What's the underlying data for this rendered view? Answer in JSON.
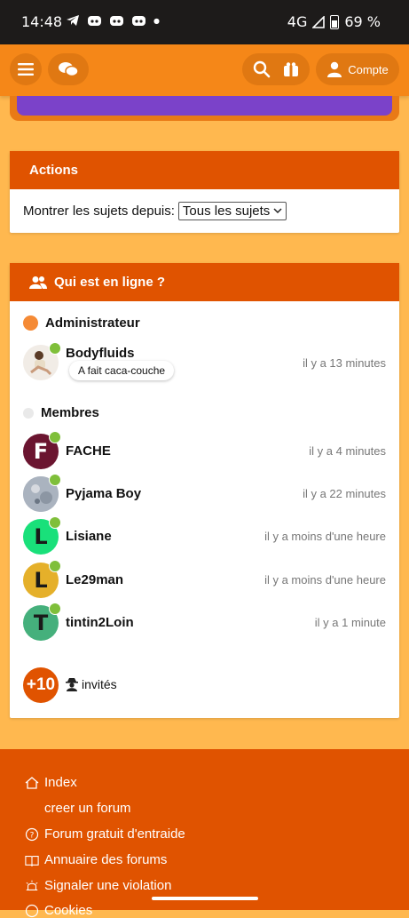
{
  "status": {
    "time": "14:48",
    "network": "4G",
    "battery": "69 %"
  },
  "nav": {
    "compte_label": "Compte"
  },
  "actions": {
    "title": "Actions",
    "show_topics_label": "Montrer les sujets depuis:",
    "show_topics_value": "Tous les sujets"
  },
  "online": {
    "title": "Qui est en ligne ?",
    "admin_group": "Administrateur",
    "admin": {
      "name": "Bodyfluids",
      "status": "A fait caca-couche",
      "time": "il y a 13 minutes"
    },
    "members_group": "Membres",
    "members": [
      {
        "initial": "F",
        "name": "FACHE",
        "time": "il y a 4 minutes",
        "color": "#6b1530"
      },
      {
        "initial": "",
        "name": "Pyjama Boy",
        "time": "il y a 22 minutes",
        "color": "#b6bcc6"
      },
      {
        "initial": "L",
        "name": "Lisiane",
        "time": "il y a moins d'une heure",
        "color": "#19e07a"
      },
      {
        "initial": "L",
        "name": "Le29man",
        "time": "il y a moins d'une heure",
        "color": "#e5b02a"
      },
      {
        "initial": "T",
        "name": "tintin2Loin",
        "time": "il y a 1 minute",
        "color": "#45b07c"
      }
    ],
    "guests_count": "+10",
    "guests_label": "invités"
  },
  "footer": {
    "links": [
      {
        "label": "Index",
        "icon": "home-icon"
      },
      {
        "label": "creer un forum",
        "icon": ""
      },
      {
        "label": "Forum gratuit d'entraide",
        "icon": "help-icon"
      },
      {
        "label": "Annuaire des forums",
        "icon": "book-icon"
      },
      {
        "label": "Signaler une violation",
        "icon": "alarm-icon"
      },
      {
        "label": "Cookies",
        "icon": "info-icon"
      }
    ]
  }
}
